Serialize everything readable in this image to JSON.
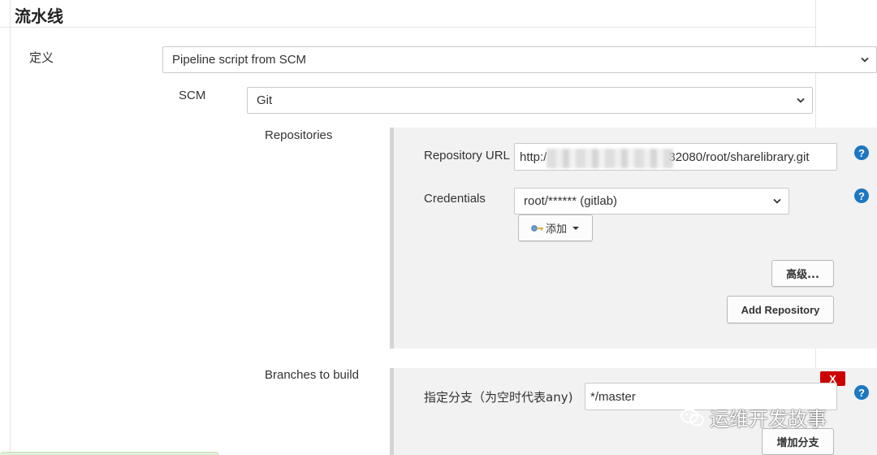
{
  "section": {
    "title": "流水线"
  },
  "definition": {
    "label": "定义",
    "selected": "Pipeline script from SCM"
  },
  "scm": {
    "label": "SCM",
    "selected": "Git"
  },
  "repositories": {
    "label": "Repositories",
    "url_label": "Repository URL",
    "url_prefix": "http:/",
    "url_suffix": "32080/root/sharelibrary.git",
    "credentials_label": "Credentials",
    "credentials_selected": "root/****** (gitlab)",
    "add_button": "添加",
    "advanced_button": "高级...",
    "add_repository_button": "Add Repository"
  },
  "branches": {
    "label": "Branches to build",
    "specifier_label": "指定分支（为空时代表any)",
    "specifier_value": "*/master",
    "delete_label": "X",
    "add_branch_button": "增加分支"
  },
  "help_text": "?",
  "watermark": "运维开发故事",
  "colors": {
    "help_blue": "#1d78c1",
    "delete_red": "#cc0000",
    "panel_bg": "#f2f2f2"
  }
}
